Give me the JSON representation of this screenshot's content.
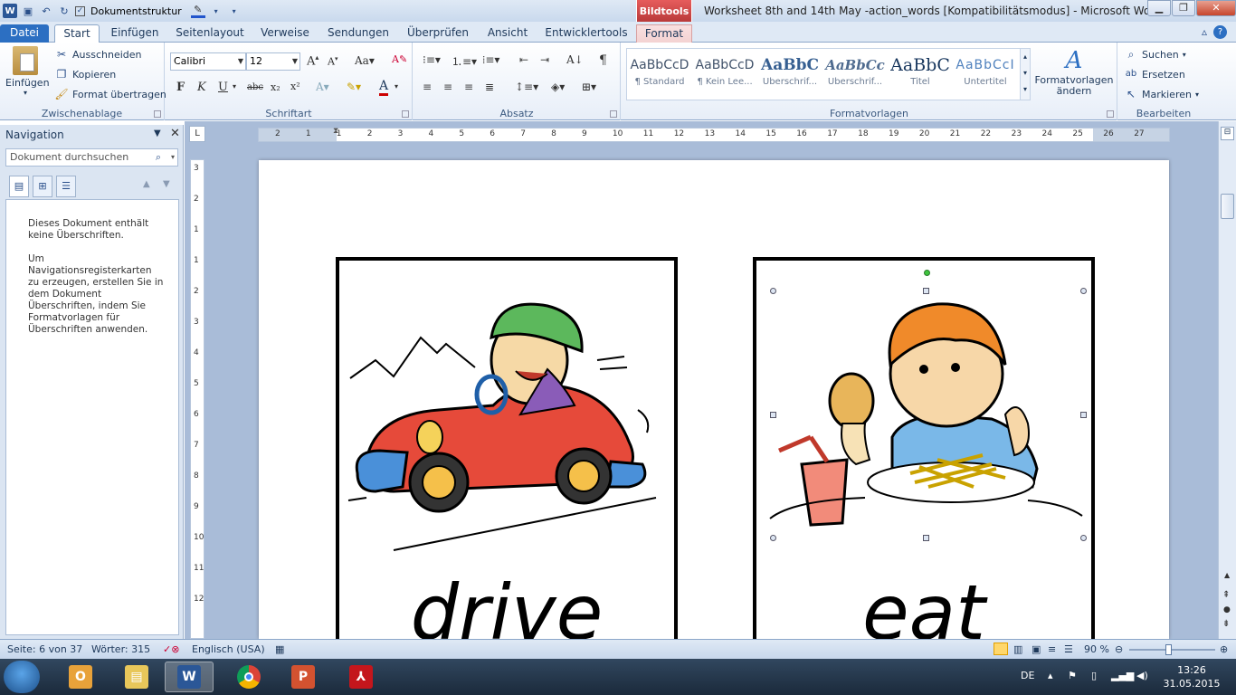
{
  "titlebar": {
    "doc_struct_label": "Dokumentstruktur",
    "context_group": "Bildtools",
    "window_title": "Worksheet 8th and 14th May -action_words [Kompatibilitätsmodus]  -  Microsoft Word ..."
  },
  "tabs": {
    "file": "Datei",
    "start": "Start",
    "insert": "Einfügen",
    "layout": "Seitenlayout",
    "references": "Verweise",
    "mailings": "Sendungen",
    "review": "Überprüfen",
    "view": "Ansicht",
    "developer": "Entwicklertools",
    "format": "Format"
  },
  "clipboard": {
    "paste": "Einfügen",
    "cut": "Ausschneiden",
    "copy": "Kopieren",
    "format_painter": "Format übertragen",
    "label": "Zwischenablage"
  },
  "font": {
    "name": "Calibri",
    "size": "12",
    "bold": "F",
    "italic": "K",
    "underline": "U",
    "strike": "abc",
    "sub": "x₂",
    "sup": "x²",
    "label": "Schriftart"
  },
  "paragraph": {
    "label": "Absatz"
  },
  "styles": {
    "items": [
      {
        "sample": "AaBbCcD",
        "name": "¶ Standard"
      },
      {
        "sample": "AaBbCcD",
        "name": "¶ Kein Lee..."
      },
      {
        "sample": "AaBbC",
        "name": "Überschrif..."
      },
      {
        "sample": "AaBbCc",
        "name": "Überschrif..."
      },
      {
        "sample": "AaBbC",
        "name": "Titel"
      },
      {
        "sample": "AaBbCcI",
        "name": "Untertitel"
      }
    ],
    "change": "Formatvorlagen ändern",
    "label": "Formatvorlagen"
  },
  "editing": {
    "find": "Suchen",
    "replace": "Ersetzen",
    "select": "Markieren",
    "label": "Bearbeiten"
  },
  "navigation": {
    "title": "Navigation",
    "search_placeholder": "Dokument durchsuchen",
    "msg1": "Dieses Dokument enthält keine Überschriften.",
    "msg2": "Um Navigationsregisterkarten zu erzeugen, erstellen Sie in dem Dokument Überschriften, indem Sie Formatvorlagen für Überschriften anwenden."
  },
  "ruler": {
    "h_numbers": [
      "2",
      "1",
      "1",
      "2",
      "3",
      "4",
      "5",
      "6",
      "7",
      "8",
      "9",
      "10",
      "11",
      "12",
      "13",
      "14",
      "15",
      "16",
      "17",
      "18",
      "19",
      "20",
      "21",
      "22",
      "23",
      "24",
      "25",
      "26",
      "27"
    ],
    "v_numbers": [
      "3",
      "2",
      "1",
      "1",
      "2",
      "3",
      "4",
      "5",
      "6",
      "7",
      "8",
      "9",
      "10",
      "11",
      "12"
    ]
  },
  "document": {
    "card1_word": "drive",
    "card2_word": "eat"
  },
  "status": {
    "page": "Seite: 6 von 37",
    "words": "Wörter: 315",
    "language": "Englisch (USA)",
    "zoom": "90 %"
  },
  "taskbar": {
    "lang": "DE",
    "time": "13:26",
    "date": "31.05.2015"
  }
}
